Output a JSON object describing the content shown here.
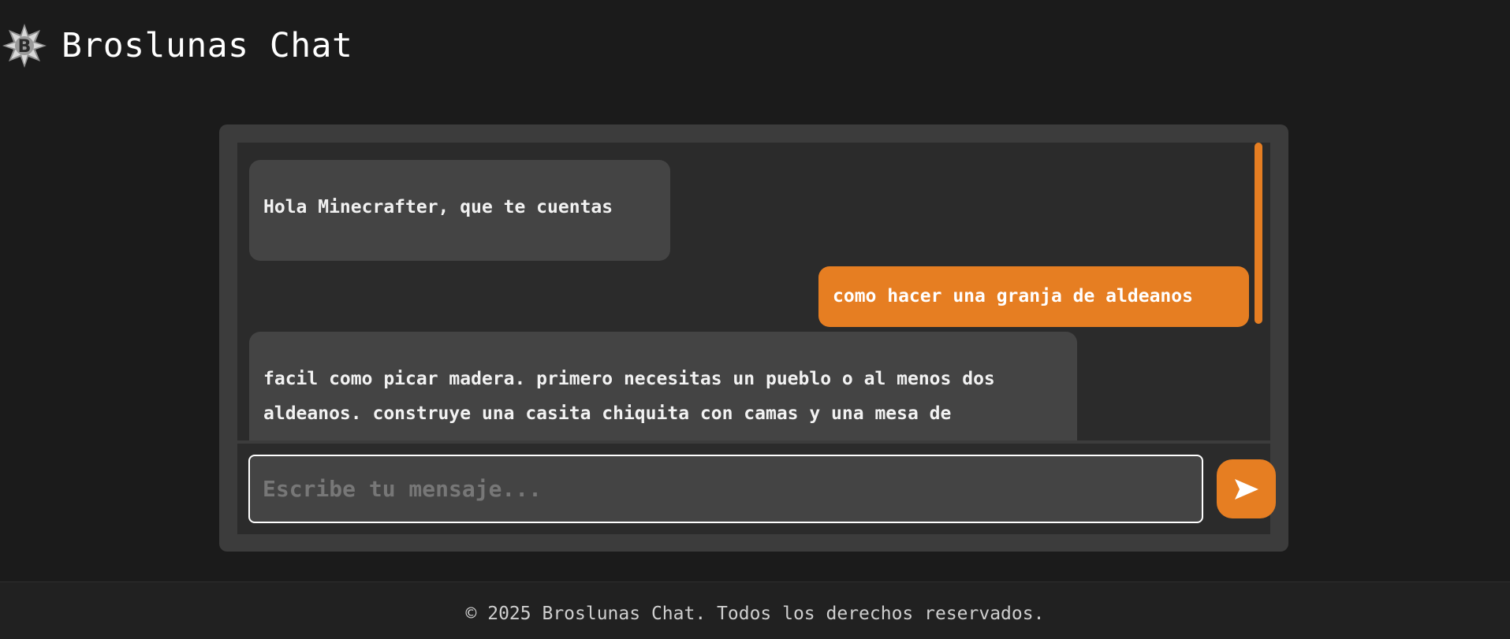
{
  "header": {
    "title": "Broslunas Chat",
    "logo_icon": "broslunas-logo-icon"
  },
  "chat": {
    "messages": [
      {
        "role": "bot",
        "text": "Hola Minecrafter, que te cuentas"
      },
      {
        "role": "user",
        "text": "como hacer una granja de aldeanos"
      },
      {
        "role": "bot",
        "text": "facil como picar madera. primero necesitas un pueblo o al menos dos aldeanos. construye una casita chiquita con camas y una mesa de"
      }
    ],
    "input": {
      "value": "",
      "placeholder": "Escribe tu mensaje..."
    },
    "send_icon": "send-icon"
  },
  "footer": {
    "text": "© 2025 Broslunas Chat. Todos los derechos reservados."
  },
  "colors": {
    "background": "#1b1b1b",
    "card": "#3c3c3c",
    "panel": "#2b2b2b",
    "bot_bubble": "#444444",
    "accent": "#e67e22",
    "text": "#ffffff"
  }
}
